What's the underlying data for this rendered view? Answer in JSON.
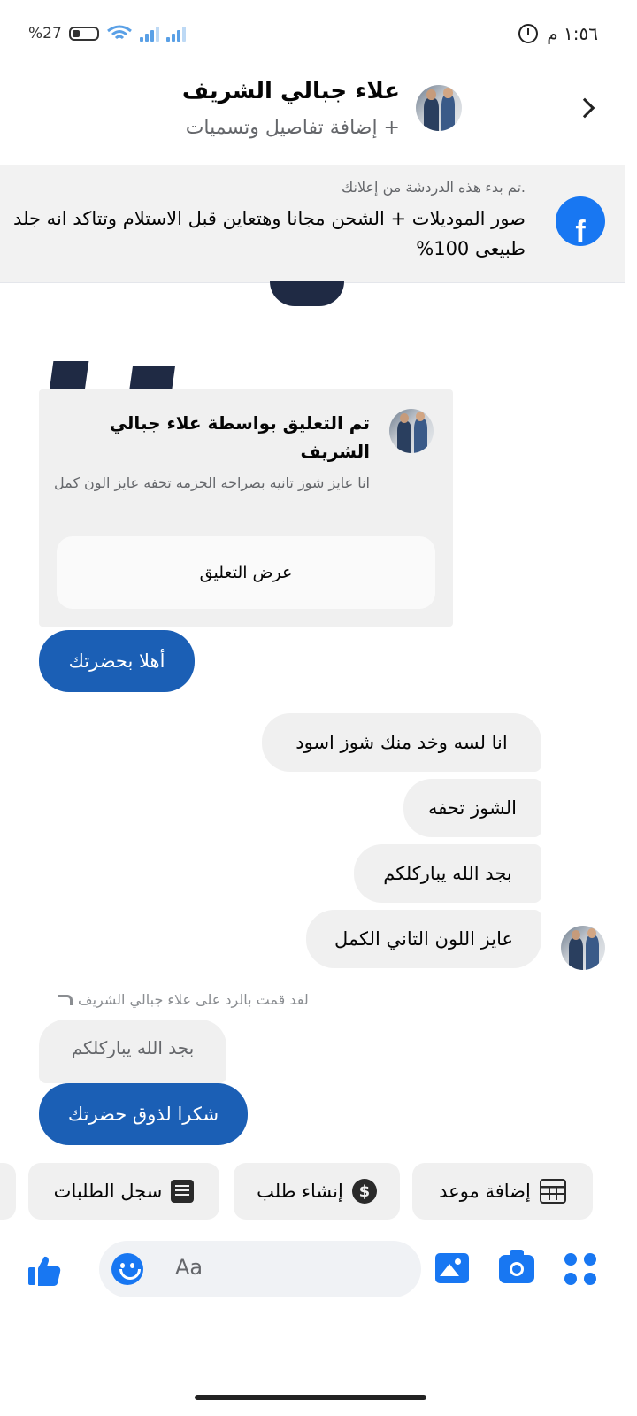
{
  "status_bar": {
    "battery": "27",
    "battery_percent_sign": "%",
    "time": "١:٥٦ م"
  },
  "header": {
    "name": "علاء جبالي الشريف",
    "subtitle": "+ إضافة تفاصيل وتسميات"
  },
  "ad_banner": {
    "caption": ".تم بدء هذه الدردشة من إعلانك",
    "text": "صور الموديلات + الشحن مجانا وهتعاين قبل الاستلام وتتاكد انه جلد طبيعى 100%"
  },
  "comment_card": {
    "title": "تم التعليق بواسطة علاء جبالي الشريف",
    "text": "انا عايز شوز تانيه بصراحه الجزمه تحفه عايز الون كمل",
    "button": "عرض التعليق"
  },
  "messages": [
    {
      "direction": "out",
      "text": "أهلا بحضرتك"
    },
    {
      "direction": "in",
      "text": "انا لسه وخد منك شوز اسود"
    },
    {
      "direction": "in",
      "text": "الشوز تحفه"
    },
    {
      "direction": "in",
      "text": "بجد الله يباركلكم"
    },
    {
      "direction": "in",
      "text": "عايز اللون التاني الكمل"
    }
  ],
  "reply": {
    "note": "لقد قمت بالرد على علاء جبالي الشريف",
    "quoted": "بجد الله يباركلكم",
    "text": "شكرا لذوق حضرتك"
  },
  "quick_actions": [
    {
      "label": "سجل الطلبات",
      "icon": "order-list-icon"
    },
    {
      "label": "إنشاء طلب",
      "icon": "dollar-icon"
    },
    {
      "label": "إضافة موعد",
      "icon": "calendar-icon"
    }
  ],
  "composer": {
    "placeholder": "Aa"
  },
  "colors": {
    "accent": "#1877f2",
    "outgoing_bubble": "#1b5fb5",
    "incoming_bubble": "#f0f0f0"
  }
}
